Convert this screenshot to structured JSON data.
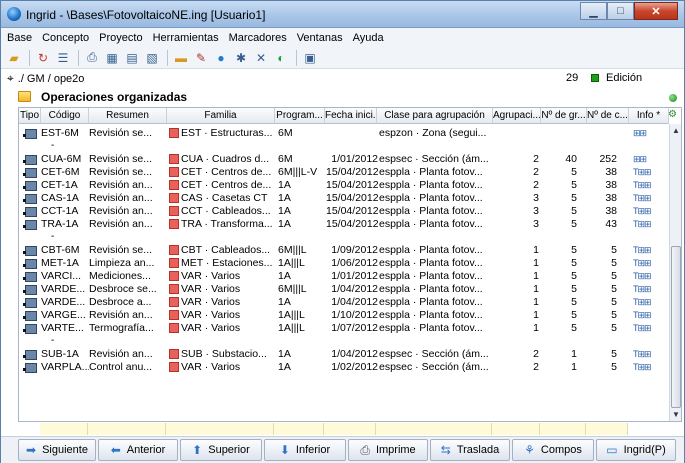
{
  "window": {
    "title": "Ingrid - \\Bases\\FotovoltaicoNE.ing  [Usuario1]"
  },
  "menu": [
    "Base",
    "Concepto",
    "Proyecto",
    "Herramientas",
    "Marcadores",
    "Ventanas",
    "Ayuda"
  ],
  "path": {
    "text": "./ GM / ope2o",
    "count": "29",
    "mode": "Edición"
  },
  "section": {
    "title": "Operaciones organizadas"
  },
  "columns": [
    "Tipo",
    "Código",
    "Resumen",
    "Familia",
    "Program...",
    "Fecha inici...",
    "Clase para agrupación",
    "Agrupaci...",
    "Nº de gr...",
    "Nº de c...",
    "Info *"
  ],
  "rows": [
    {
      "codigo": "EST-6M",
      "resumen": "Revisión se...",
      "familia": "EST · Estructuras...",
      "prog": "6M",
      "fecha": "",
      "clase": "espzon · Zona (segui...",
      "agrup": "",
      "ngr": "",
      "nc": "",
      "info": "⊞⊞",
      "dash": true
    },
    {
      "codigo": "CUA-6M",
      "resumen": "Revisión se...",
      "familia": "CUA · Cuadros d...",
      "prog": "6M",
      "fecha": "1/01/2012",
      "clase": "espsec · Sección (ám...",
      "agrup": "2",
      "ngr": "40",
      "nc": "252",
      "info": "⊞⊞",
      "dash": false
    },
    {
      "codigo": "CET-6M",
      "resumen": "Revisión se...",
      "familia": "CET · Centros de...",
      "prog": "6M|||L-V",
      "fecha": "15/04/2012",
      "clase": "esppla · Planta fotov...",
      "agrup": "2",
      "ngr": "5",
      "nc": "38",
      "info": "T⊞⊞",
      "dash": false
    },
    {
      "codigo": "CET-1A",
      "resumen": "Revisión an...",
      "familia": "CET · Centros de...",
      "prog": "1A",
      "fecha": "15/04/2012",
      "clase": "esppla · Planta fotov...",
      "agrup": "2",
      "ngr": "5",
      "nc": "38",
      "info": "T⊞⊞",
      "dash": false
    },
    {
      "codigo": "CAS-1A",
      "resumen": "Revisión an...",
      "familia": "CAS · Casetas CT",
      "prog": "1A",
      "fecha": "15/04/2012",
      "clase": "esppla · Planta fotov...",
      "agrup": "3",
      "ngr": "5",
      "nc": "38",
      "info": "T⊞⊞",
      "dash": false
    },
    {
      "codigo": "CCT-1A",
      "resumen": "Revisión an...",
      "familia": "CCT · Cableados...",
      "prog": "1A",
      "fecha": "15/04/2012",
      "clase": "esppla · Planta fotov...",
      "agrup": "3",
      "ngr": "5",
      "nc": "38",
      "info": "T⊞⊞",
      "dash": false
    },
    {
      "codigo": "TRA-1A",
      "resumen": "Revisión an...",
      "familia": "TRA · Transforma...",
      "prog": "1A",
      "fecha": "15/04/2012",
      "clase": "esppla · Planta fotov...",
      "agrup": "3",
      "ngr": "5",
      "nc": "43",
      "info": "T⊞⊞",
      "dash": true
    },
    {
      "codigo": "CBT-6M",
      "resumen": "Revisión se...",
      "familia": "CBT · Cableados...",
      "prog": "6M|||L",
      "fecha": "1/09/2012",
      "clase": "esppla · Planta fotov...",
      "agrup": "1",
      "ngr": "5",
      "nc": "5",
      "info": "T⊞⊞",
      "dash": false
    },
    {
      "codigo": "MET-1A",
      "resumen": "Limpieza an...",
      "familia": "MET · Estaciones...",
      "prog": "1A|||L",
      "fecha": "1/06/2012",
      "clase": "esppla · Planta fotov...",
      "agrup": "1",
      "ngr": "5",
      "nc": "5",
      "info": "T⊞⊞",
      "dash": false
    },
    {
      "codigo": "VARCI...",
      "resumen": "Mediciones...",
      "familia": "VAR · Varios",
      "prog": "1A",
      "fecha": "1/01/2012",
      "clase": "esppla · Planta fotov...",
      "agrup": "1",
      "ngr": "5",
      "nc": "5",
      "info": "T⊞⊞",
      "dash": false
    },
    {
      "codigo": "VARDE...",
      "resumen": "Desbroce se...",
      "familia": "VAR · Varios",
      "prog": "6M|||L",
      "fecha": "1/04/2012",
      "clase": "esppla · Planta fotov...",
      "agrup": "1",
      "ngr": "5",
      "nc": "5",
      "info": "T⊞⊞",
      "dash": false
    },
    {
      "codigo": "VARDE...",
      "resumen": "Desbroce a...",
      "familia": "VAR · Varios",
      "prog": "1A",
      "fecha": "1/04/2012",
      "clase": "esppla · Planta fotov...",
      "agrup": "1",
      "ngr": "5",
      "nc": "5",
      "info": "T⊞⊞",
      "dash": false
    },
    {
      "codigo": "VARGE...",
      "resumen": "Revisión an...",
      "familia": "VAR · Varios",
      "prog": "1A|||L",
      "fecha": "1/10/2012",
      "clase": "esppla · Planta fotov...",
      "agrup": "1",
      "ngr": "5",
      "nc": "5",
      "info": "T⊞⊞",
      "dash": false
    },
    {
      "codigo": "VARTE...",
      "resumen": "Termografía...",
      "familia": "VAR · Varios",
      "prog": "1A|||L",
      "fecha": "1/07/2012",
      "clase": "esppla · Planta fotov...",
      "agrup": "1",
      "ngr": "5",
      "nc": "5",
      "info": "T⊞⊞",
      "dash": true
    },
    {
      "codigo": "SUB-1A",
      "resumen": "Revisión an...",
      "familia": "SUB · Substacio...",
      "prog": "1A",
      "fecha": "1/04/2012",
      "clase": "espsec · Sección (ám...",
      "agrup": "2",
      "ngr": "1",
      "nc": "5",
      "info": "T⊞⊞",
      "dash": false
    },
    {
      "codigo": "VARPLA...",
      "resumen": "Control anu...",
      "familia": "VAR · Varios",
      "prog": "1A",
      "fecha": "1/02/2012",
      "clase": "espsec · Sección (ám...",
      "agrup": "2",
      "ngr": "1",
      "nc": "5",
      "info": "T⊞⊞",
      "dash": false
    }
  ],
  "buttons": [
    {
      "label": "Siguiente",
      "icon": "arrow-right-icon"
    },
    {
      "label": "Anterior",
      "icon": "arrow-left-icon"
    },
    {
      "label": "Superior",
      "icon": "arrow-up-icon"
    },
    {
      "label": "Inferior",
      "icon": "arrow-down-icon"
    },
    {
      "label": "Imprime",
      "icon": "printer-icon"
    },
    {
      "label": "Traslada",
      "icon": "move-icon"
    },
    {
      "label": "Compos",
      "icon": "tree-icon"
    },
    {
      "label": "Ingrid(P)",
      "icon": "window-icon"
    }
  ]
}
